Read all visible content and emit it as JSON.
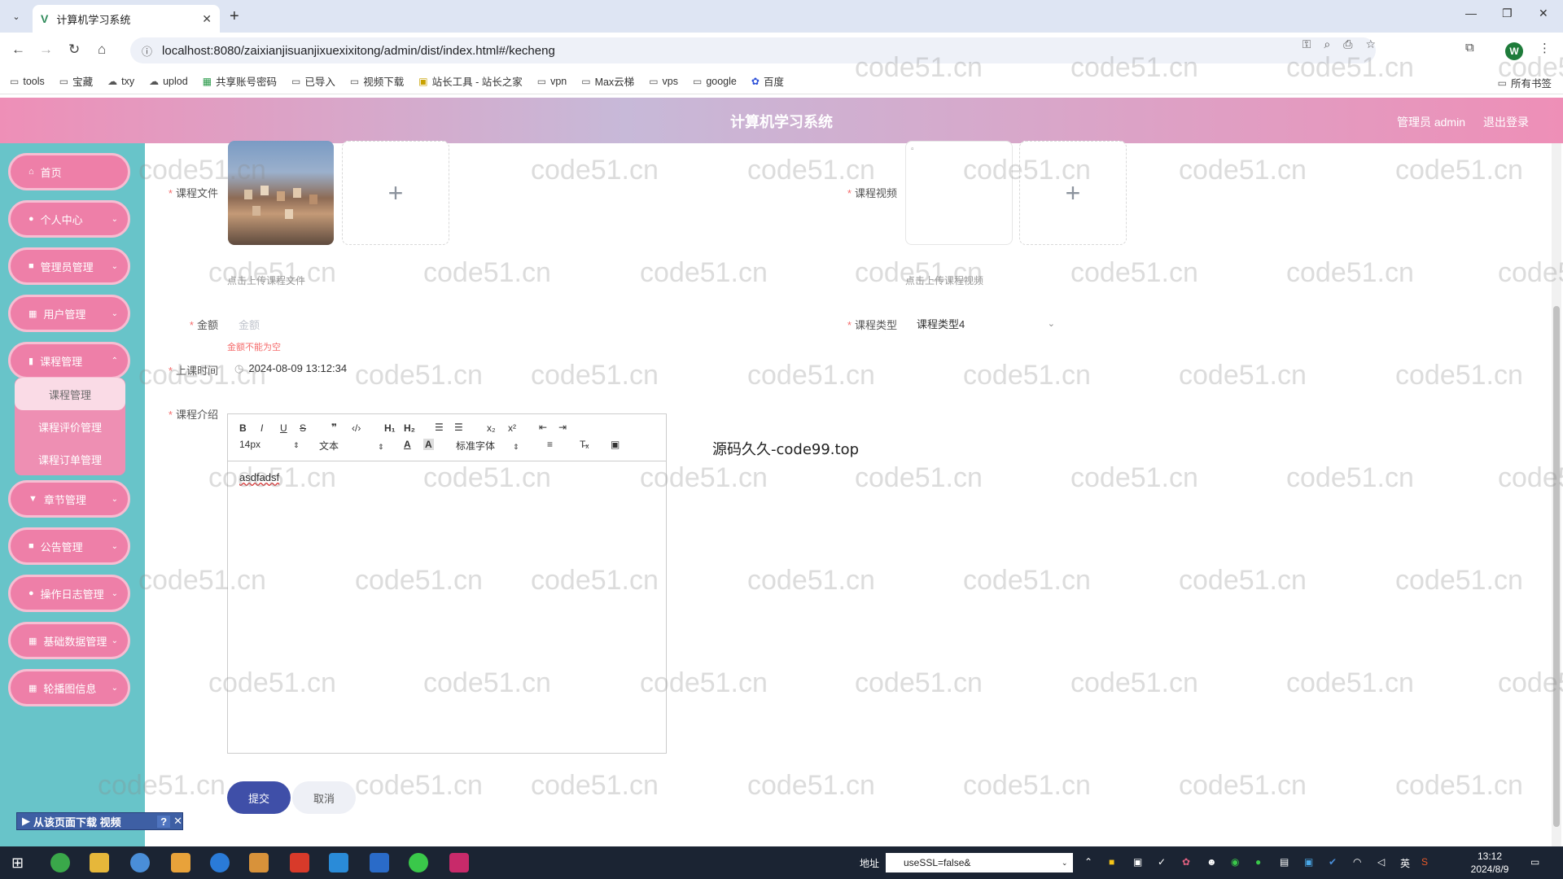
{
  "browser": {
    "tab_title": "计算机学习系统",
    "url": "localhost:8080/zaixianjisuanjixuexixitong/admin/dist/index.html#/kecheng",
    "bookmarks": [
      "tools",
      "宝藏",
      "txy",
      "uplod",
      "共享账号密码",
      "已导入",
      "视频下载",
      "站长工具 - 站长之家",
      "vpn",
      "Max云梯",
      "vps",
      "google",
      "百度"
    ],
    "all_bookmarks": "所有书签",
    "avatar_letter": "W"
  },
  "app": {
    "title": "计算机学习系统",
    "user_label": "管理员 admin",
    "logout_label": "退出登录"
  },
  "sidebar": {
    "items": [
      {
        "label": "首页"
      },
      {
        "label": "个人中心"
      },
      {
        "label": "管理员管理"
      },
      {
        "label": "用户管理"
      },
      {
        "label": "课程管理"
      },
      {
        "label": "章节管理"
      },
      {
        "label": "公告管理"
      },
      {
        "label": "操作日志管理"
      },
      {
        "label": "基础数据管理"
      },
      {
        "label": "轮播图信息"
      }
    ],
    "sub_items": [
      {
        "label": "课程管理",
        "active": true
      },
      {
        "label": "课程评价管理",
        "active": false
      },
      {
        "label": "课程订单管理",
        "active": false
      }
    ]
  },
  "form": {
    "course_file_label": "课程文件",
    "course_file_hint": "点击上传课程文件",
    "course_video_label": "课程视频",
    "course_video_hint": "点击上传课程视频",
    "amount_label": "金额",
    "amount_placeholder": "金额",
    "amount_error": "金额不能为空",
    "type_label": "课程类型",
    "type_value": "课程类型4",
    "time_label": "上课时间",
    "time_value": "2024-08-09 13:12:34",
    "intro_label": "课程介绍",
    "editor_font_size": "14px",
    "editor_block": "文本",
    "editor_font": "标准字体",
    "editor_content": "asdfadsf",
    "submit_label": "提交",
    "cancel_label": "取消"
  },
  "side_note": "源码久久-code99.top",
  "watermark": "code51.cn",
  "download_bar": "从该页面下载 视频",
  "taskbar": {
    "addr_label": "地址",
    "addr_value": "useSSL=false&",
    "time": "13:12",
    "date": "2024/8/9",
    "ime": "英"
  }
}
